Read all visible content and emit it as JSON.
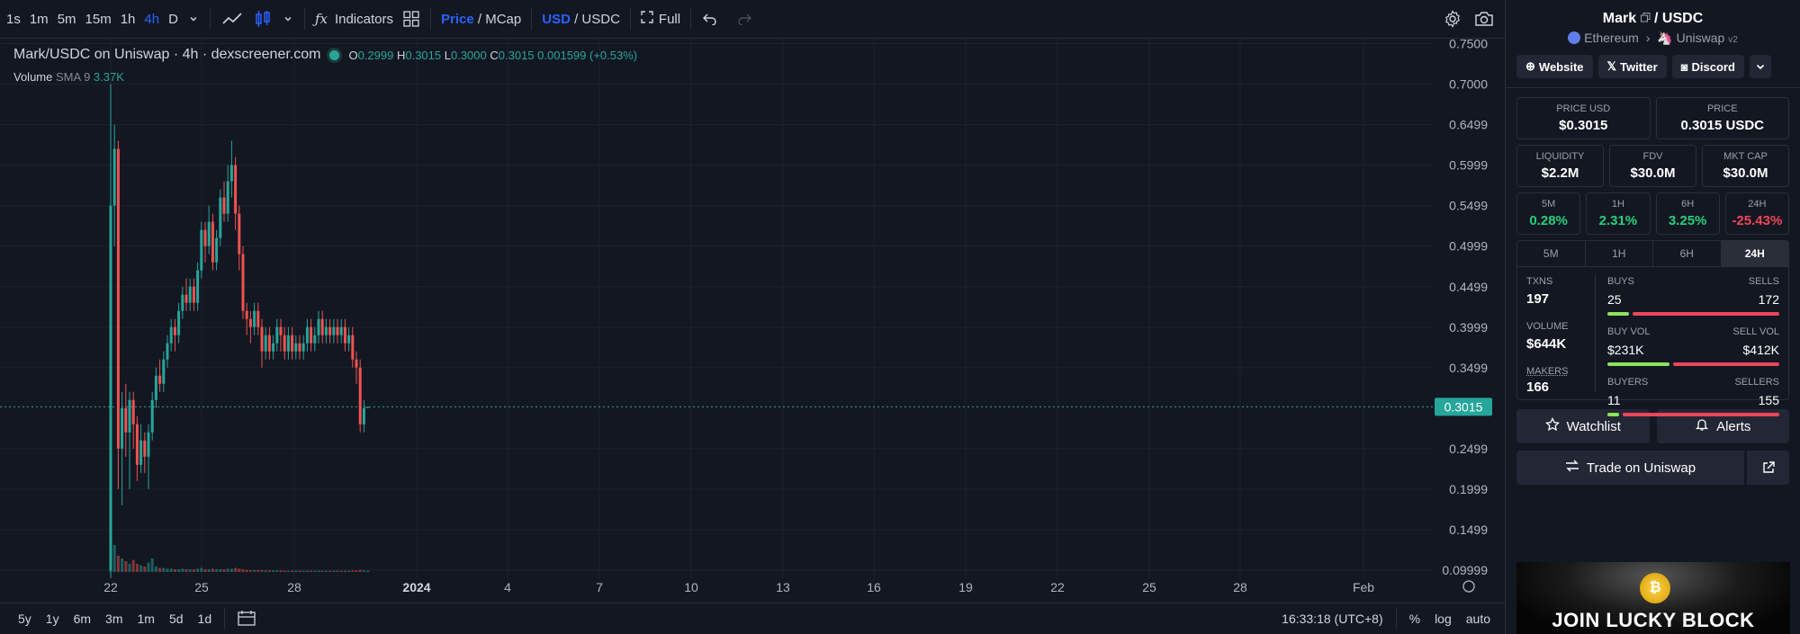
{
  "toolbar": {
    "intervals": [
      "1s",
      "1m",
      "5m",
      "15m",
      "1h",
      "4h",
      "D"
    ],
    "active_interval": "4h",
    "indicators_label": "Indicators",
    "price_label": "Price",
    "mcap_label": "/ MCap",
    "usd_label": "USD",
    "usdc_label": "/ USDC",
    "full_label": "Full"
  },
  "legend": {
    "title": "Mark/USDC on Uniswap · 4h · dexscreener.com",
    "o_label": "O",
    "o": "0.2999",
    "h_label": "H",
    "h": "0.3015",
    "l_label": "L",
    "l": "0.3000",
    "c_label": "C",
    "c": "0.3015",
    "change": "0.001599 (+0.53%)",
    "volume_label": "Volume",
    "sma_label": "SMA 9",
    "volume_value": "3.37K"
  },
  "chart_data": {
    "type": "candlestick",
    "y_ticks": [
      "0.7500",
      "0.7000",
      "0.6499",
      "0.5999",
      "0.5499",
      "0.4999",
      "0.4499",
      "0.3999",
      "0.3499",
      "0.2499",
      "0.1999",
      "0.1499",
      "0.09999"
    ],
    "ylim": [
      0.0999,
      0.755
    ],
    "x_ticks": [
      "22",
      "25",
      "28",
      "2024",
      "4",
      "7",
      "10",
      "13",
      "16",
      "19",
      "22",
      "25",
      "28",
      "Feb"
    ],
    "last_price_label": "0.3015",
    "colors": {
      "up": "#26a69a",
      "down": "#ef5350"
    },
    "candles": [
      [
        0.1,
        0.55,
        0.7,
        0.09
      ],
      [
        0.55,
        0.62,
        0.65,
        0.5
      ],
      [
        0.62,
        0.25,
        0.63,
        0.2
      ],
      [
        0.25,
        0.3,
        0.32,
        0.18
      ],
      [
        0.3,
        0.27,
        0.33,
        0.24
      ],
      [
        0.27,
        0.31,
        0.32,
        0.2
      ],
      [
        0.31,
        0.28,
        0.32,
        0.25
      ],
      [
        0.28,
        0.23,
        0.29,
        0.21
      ],
      [
        0.23,
        0.26,
        0.28,
        0.22
      ],
      [
        0.26,
        0.24,
        0.27,
        0.22
      ],
      [
        0.24,
        0.27,
        0.28,
        0.2
      ],
      [
        0.27,
        0.31,
        0.32,
        0.26
      ],
      [
        0.31,
        0.34,
        0.35,
        0.3
      ],
      [
        0.34,
        0.33,
        0.36,
        0.32
      ],
      [
        0.33,
        0.36,
        0.37,
        0.32
      ],
      [
        0.36,
        0.38,
        0.39,
        0.35
      ],
      [
        0.38,
        0.4,
        0.41,
        0.37
      ],
      [
        0.4,
        0.39,
        0.41,
        0.37
      ],
      [
        0.39,
        0.42,
        0.43,
        0.38
      ],
      [
        0.42,
        0.44,
        0.45,
        0.41
      ],
      [
        0.44,
        0.43,
        0.46,
        0.42
      ],
      [
        0.43,
        0.45,
        0.46,
        0.42
      ],
      [
        0.45,
        0.43,
        0.46,
        0.42
      ],
      [
        0.43,
        0.47,
        0.48,
        0.42
      ],
      [
        0.47,
        0.52,
        0.53,
        0.46
      ],
      [
        0.52,
        0.5,
        0.53,
        0.48
      ],
      [
        0.5,
        0.53,
        0.55,
        0.49
      ],
      [
        0.53,
        0.48,
        0.54,
        0.47
      ],
      [
        0.48,
        0.51,
        0.52,
        0.47
      ],
      [
        0.51,
        0.56,
        0.57,
        0.5
      ],
      [
        0.56,
        0.54,
        0.58,
        0.53
      ],
      [
        0.54,
        0.58,
        0.6,
        0.53
      ],
      [
        0.58,
        0.6,
        0.63,
        0.56
      ],
      [
        0.6,
        0.54,
        0.61,
        0.52
      ],
      [
        0.54,
        0.49,
        0.55,
        0.47
      ],
      [
        0.49,
        0.42,
        0.5,
        0.41
      ],
      [
        0.42,
        0.41,
        0.43,
        0.39
      ],
      [
        0.41,
        0.4,
        0.42,
        0.38
      ],
      [
        0.4,
        0.42,
        0.43,
        0.39
      ],
      [
        0.42,
        0.4,
        0.43,
        0.39
      ],
      [
        0.4,
        0.37,
        0.41,
        0.35
      ],
      [
        0.37,
        0.39,
        0.4,
        0.36
      ],
      [
        0.39,
        0.37,
        0.4,
        0.36
      ],
      [
        0.37,
        0.38,
        0.39,
        0.36
      ],
      [
        0.38,
        0.4,
        0.41,
        0.37
      ],
      [
        0.4,
        0.39,
        0.41,
        0.37
      ],
      [
        0.39,
        0.37,
        0.4,
        0.36
      ],
      [
        0.37,
        0.39,
        0.4,
        0.36
      ],
      [
        0.39,
        0.37,
        0.4,
        0.36
      ],
      [
        0.37,
        0.38,
        0.39,
        0.36
      ],
      [
        0.38,
        0.37,
        0.39,
        0.36
      ],
      [
        0.37,
        0.38,
        0.39,
        0.36
      ],
      [
        0.38,
        0.4,
        0.41,
        0.37
      ],
      [
        0.4,
        0.38,
        0.41,
        0.37
      ],
      [
        0.38,
        0.39,
        0.4,
        0.37
      ],
      [
        0.39,
        0.41,
        0.42,
        0.38
      ],
      [
        0.41,
        0.39,
        0.42,
        0.38
      ],
      [
        0.39,
        0.4,
        0.41,
        0.38
      ],
      [
        0.4,
        0.39,
        0.41,
        0.38
      ],
      [
        0.39,
        0.4,
        0.41,
        0.38
      ],
      [
        0.4,
        0.39,
        0.41,
        0.38
      ],
      [
        0.39,
        0.4,
        0.41,
        0.38
      ],
      [
        0.4,
        0.38,
        0.41,
        0.37
      ],
      [
        0.38,
        0.39,
        0.4,
        0.37
      ],
      [
        0.39,
        0.36,
        0.4,
        0.35
      ],
      [
        0.36,
        0.35,
        0.37,
        0.33
      ],
      [
        0.35,
        0.28,
        0.36,
        0.27
      ],
      [
        0.28,
        0.3,
        0.31,
        0.27
      ],
      [
        0.3,
        0.3015,
        0.3015,
        0.2999
      ]
    ],
    "volumes": [
      0.2,
      1.0,
      0.6,
      0.5,
      0.4,
      0.3,
      0.45,
      0.3,
      0.25,
      0.2,
      0.35,
      0.5,
      0.2,
      0.15,
      0.15,
      0.12,
      0.12,
      0.1,
      0.1,
      0.12,
      0.1,
      0.1,
      0.1,
      0.12,
      0.15,
      0.1,
      0.1,
      0.12,
      0.1,
      0.1,
      0.1,
      0.12,
      0.12,
      0.15,
      0.12,
      0.1,
      0.08,
      0.07,
      0.07,
      0.07,
      0.07,
      0.06,
      0.06,
      0.06,
      0.06,
      0.06,
      0.05,
      0.05,
      0.05,
      0.05,
      0.05,
      0.05,
      0.05,
      0.05,
      0.05,
      0.05,
      0.05,
      0.05,
      0.05,
      0.05,
      0.05,
      0.05,
      0.05,
      0.05,
      0.06,
      0.06,
      0.08,
      0.06,
      0.05
    ]
  },
  "bottombar": {
    "ranges": [
      "5y",
      "1y",
      "6m",
      "3m",
      "1m",
      "5d",
      "1d"
    ],
    "time": "16:33:18 (UTC+8)",
    "percent": "%",
    "log": "log",
    "auto": "auto"
  },
  "panel": {
    "pair_base": "Mark",
    "pair_quote": "/ USDC",
    "chain": "Ethereum",
    "dex": "Uniswap",
    "dex_version": "v2",
    "links": [
      "Website",
      "Twitter",
      "Discord"
    ],
    "price_usd_label": "PRICE USD",
    "price_usd": "$0.3015",
    "price_label": "PRICE",
    "price": "0.3015 USDC",
    "liquidity_label": "LIQUIDITY",
    "liquidity": "$2.2M",
    "fdv_label": "FDV",
    "fdv": "$30.0M",
    "mktcap_label": "MKT CAP",
    "mktcap": "$30.0M",
    "changes": [
      {
        "label": "5M",
        "value": "0.28%"
      },
      {
        "label": "1H",
        "value": "2.31%"
      },
      {
        "label": "6H",
        "value": "3.25%"
      },
      {
        "label": "24H",
        "value": "-25.43%"
      }
    ],
    "tabs": [
      "5M",
      "1H",
      "6H",
      "24H"
    ],
    "active_tab": "24H",
    "txns_label": "TXNS",
    "txns": "197",
    "volume_label": "VOLUME",
    "volume": "$644K",
    "makers_label": "MAKERS",
    "makers": "166",
    "buys_label": "BUYS",
    "buys": "25",
    "sells_label": "SELLS",
    "sells": "172",
    "buy_fraction": 0.127,
    "buyvol_label": "BUY VOL",
    "buyvol": "$231K",
    "sellvol_label": "SELL VOL",
    "sellvol": "$412K",
    "buyvol_fraction": 0.359,
    "buyers_label": "BUYERS",
    "buyers": "11",
    "sellers_label": "SELLERS",
    "sellers": "155",
    "buyers_fraction": 0.066,
    "watchlist_label": "Watchlist",
    "alerts_label": "Alerts",
    "trade_label": "Trade on Uniswap",
    "ad_text": "JOIN LUCKY BLOCK"
  }
}
